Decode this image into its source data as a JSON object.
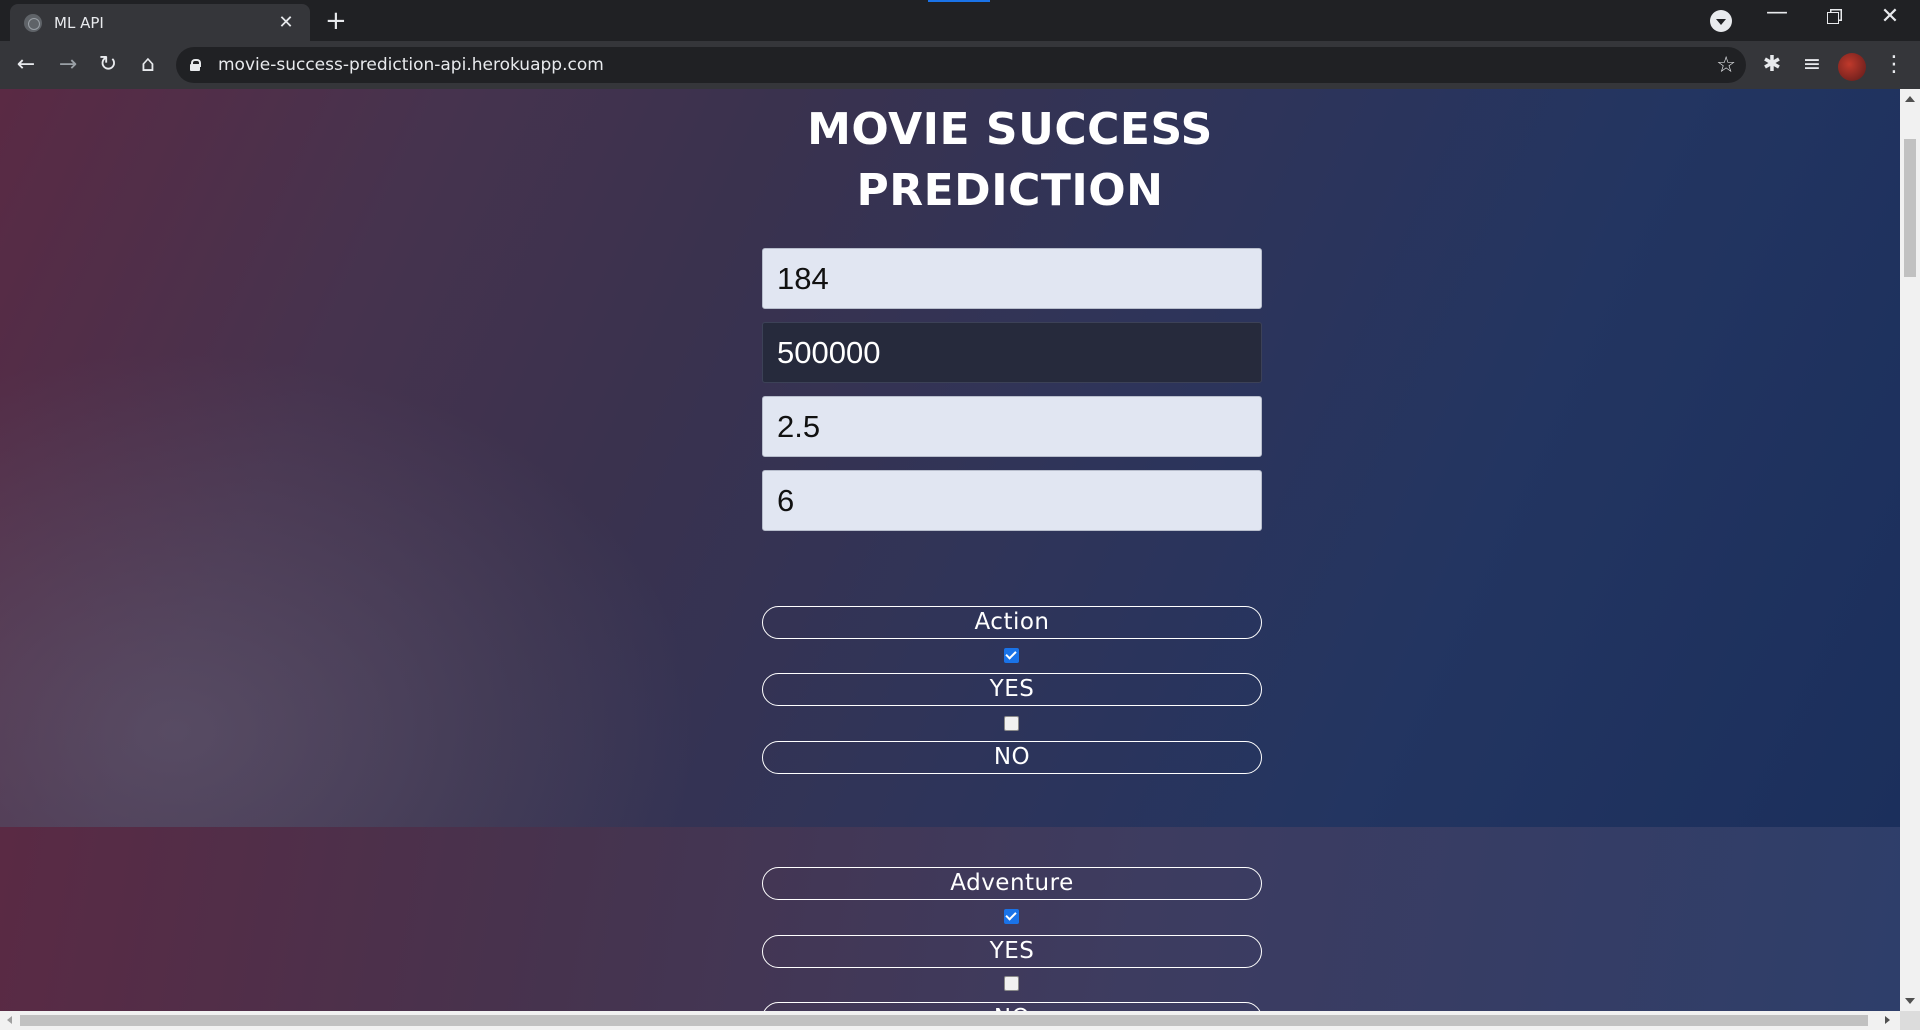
{
  "browser": {
    "tab_title": "ML API",
    "tab_close": "✕",
    "new_tab": "+",
    "url": "movie-success-prediction-api.herokuapp.com",
    "window_minimize": "—",
    "window_close": "✕"
  },
  "page": {
    "title": "MOVIE SUCCESS PREDICTION",
    "inputs": [
      {
        "value": "184"
      },
      {
        "value": "500000"
      },
      {
        "value": "2.5"
      },
      {
        "value": "6"
      }
    ],
    "genres": [
      {
        "label": "Action",
        "yes_label": "YES",
        "no_label": "NO",
        "yes_checked": true,
        "no_checked": false
      },
      {
        "label": "Adventure",
        "yes_label": "YES",
        "no_label": "NO",
        "yes_checked": true,
        "no_checked": false
      }
    ]
  },
  "colors": {
    "checkbox_checked": "#1a73e8",
    "input_background": "#e1e6f2",
    "input_focused_background": "#262a3c"
  }
}
